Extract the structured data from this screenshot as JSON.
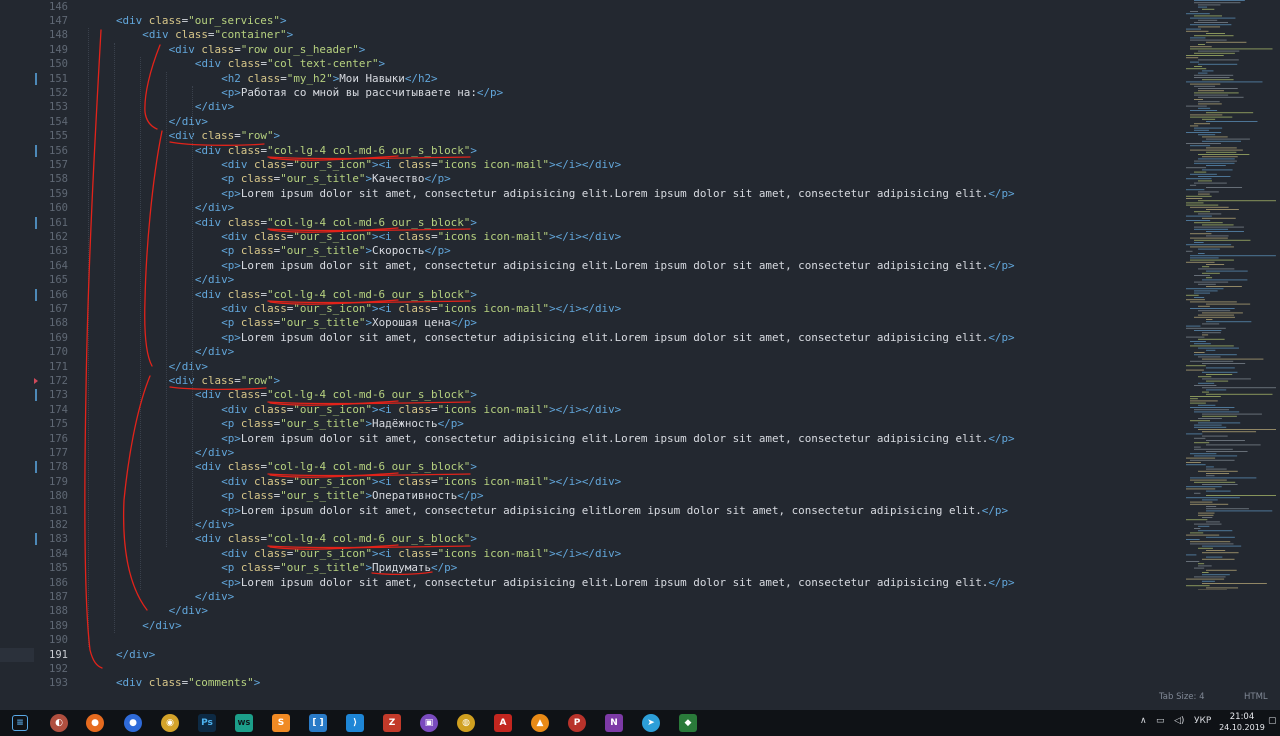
{
  "editor": {
    "lines": [
      {
        "n": "146",
        "segs": []
      },
      {
        "n": "147",
        "segs": [
          [
            "t",
            "<div "
          ],
          [
            "a",
            "class"
          ],
          [
            "x",
            "="
          ],
          [
            "s",
            "\"our_services\""
          ],
          [
            "t",
            ">"
          ]
        ]
      },
      {
        "n": "148",
        "segs": [
          [
            "t",
            "<div "
          ],
          [
            "a",
            "class"
          ],
          [
            "x",
            "="
          ],
          [
            "s",
            "\"container\""
          ],
          [
            "t",
            ">"
          ]
        ]
      },
      {
        "n": "149",
        "segs": [
          [
            "t",
            "<div "
          ],
          [
            "a",
            "class"
          ],
          [
            "x",
            "="
          ],
          [
            "s",
            "\"row our_s_header\""
          ],
          [
            "t",
            ">"
          ]
        ]
      },
      {
        "n": "150",
        "segs": [
          [
            "t",
            "<div "
          ],
          [
            "a",
            "class"
          ],
          [
            "x",
            "="
          ],
          [
            "s",
            "\"col text-center\""
          ],
          [
            "t",
            ">"
          ]
        ]
      },
      {
        "n": "151",
        "segs": [
          [
            "t",
            "<h2 "
          ],
          [
            "a",
            "class"
          ],
          [
            "x",
            "="
          ],
          [
            "s",
            "\"my_h2\""
          ],
          [
            "t",
            ">"
          ],
          [
            "x",
            "Мои Навыки"
          ],
          [
            "t",
            "</h2>"
          ]
        ]
      },
      {
        "n": "152",
        "segs": [
          [
            "t",
            "<p>"
          ],
          [
            "x",
            "Работая со мной вы рассчитываете на:"
          ],
          [
            "t",
            "</p>"
          ]
        ]
      },
      {
        "n": "153",
        "segs": [
          [
            "t",
            "</div>"
          ]
        ]
      },
      {
        "n": "154",
        "segs": [
          [
            "t",
            "</div>"
          ]
        ]
      },
      {
        "n": "155",
        "segs": [
          [
            "t",
            "<div "
          ],
          [
            "a",
            "class"
          ],
          [
            "x",
            "="
          ],
          [
            "s",
            "\"row\""
          ],
          [
            "t",
            ">"
          ]
        ]
      },
      {
        "n": "156",
        "segs": [
          [
            "t",
            "<div "
          ],
          [
            "a",
            "class"
          ],
          [
            "x",
            "="
          ],
          [
            "s",
            "\"col-lg-4 col-md-6 our_s_block\""
          ],
          [
            "t",
            ">"
          ]
        ]
      },
      {
        "n": "157",
        "segs": [
          [
            "t",
            "<div "
          ],
          [
            "a",
            "class"
          ],
          [
            "x",
            "="
          ],
          [
            "s",
            "\"our_s_icon\""
          ],
          [
            "t",
            "><i "
          ],
          [
            "a",
            "class"
          ],
          [
            "x",
            "="
          ],
          [
            "s",
            "\"icons icon-mail\""
          ],
          [
            "t",
            "></i></div>"
          ]
        ]
      },
      {
        "n": "158",
        "segs": [
          [
            "t",
            "<p "
          ],
          [
            "a",
            "class"
          ],
          [
            "x",
            "="
          ],
          [
            "s",
            "\"our_s_title\""
          ],
          [
            "t",
            ">"
          ],
          [
            "x",
            "Качество"
          ],
          [
            "t",
            "</p>"
          ]
        ]
      },
      {
        "n": "159",
        "segs": [
          [
            "t",
            "<p>"
          ],
          [
            "x",
            "Lorem ipsum dolor sit amet, consectetur adipisicing elit.Lorem ipsum dolor sit amet, consectetur adipisicing elit."
          ],
          [
            "t",
            "</p>"
          ]
        ]
      },
      {
        "n": "160",
        "segs": [
          [
            "t",
            "</div>"
          ]
        ]
      },
      {
        "n": "161",
        "segs": [
          [
            "t",
            "<div "
          ],
          [
            "a",
            "class"
          ],
          [
            "x",
            "="
          ],
          [
            "s",
            "\"col-lg-4 col-md-6 our_s_block\""
          ],
          [
            "t",
            ">"
          ]
        ]
      },
      {
        "n": "162",
        "segs": [
          [
            "t",
            "<div "
          ],
          [
            "a",
            "class"
          ],
          [
            "x",
            "="
          ],
          [
            "s",
            "\"our_s_icon\""
          ],
          [
            "t",
            "><i "
          ],
          [
            "a",
            "class"
          ],
          [
            "x",
            "="
          ],
          [
            "s",
            "\"icons icon-mail\""
          ],
          [
            "t",
            "></i></div>"
          ]
        ]
      },
      {
        "n": "163",
        "segs": [
          [
            "t",
            "<p "
          ],
          [
            "a",
            "class"
          ],
          [
            "x",
            "="
          ],
          [
            "s",
            "\"our_s_title\""
          ],
          [
            "t",
            ">"
          ],
          [
            "x",
            "Скорость"
          ],
          [
            "t",
            "</p>"
          ]
        ]
      },
      {
        "n": "164",
        "segs": [
          [
            "t",
            "<p>"
          ],
          [
            "x",
            "Lorem ipsum dolor sit amet, consectetur adipisicing elit.Lorem ipsum dolor sit amet, consectetur adipisicing elit."
          ],
          [
            "t",
            "</p>"
          ]
        ]
      },
      {
        "n": "165",
        "segs": [
          [
            "t",
            "</div>"
          ]
        ]
      },
      {
        "n": "166",
        "segs": [
          [
            "t",
            "<div "
          ],
          [
            "a",
            "class"
          ],
          [
            "x",
            "="
          ],
          [
            "s",
            "\"col-lg-4 col-md-6 our_s_block\""
          ],
          [
            "t",
            ">"
          ]
        ]
      },
      {
        "n": "167",
        "segs": [
          [
            "t",
            "<div "
          ],
          [
            "a",
            "class"
          ],
          [
            "x",
            "="
          ],
          [
            "s",
            "\"our_s_icon\""
          ],
          [
            "t",
            "><i "
          ],
          [
            "a",
            "class"
          ],
          [
            "x",
            "="
          ],
          [
            "s",
            "\"icons icon-mail\""
          ],
          [
            "t",
            "></i></div>"
          ]
        ]
      },
      {
        "n": "168",
        "segs": [
          [
            "t",
            "<p "
          ],
          [
            "a",
            "class"
          ],
          [
            "x",
            "="
          ],
          [
            "s",
            "\"our_s_title\""
          ],
          [
            "t",
            ">"
          ],
          [
            "x",
            "Хорошая цена"
          ],
          [
            "t",
            "</p>"
          ]
        ]
      },
      {
        "n": "169",
        "segs": [
          [
            "t",
            "<p>"
          ],
          [
            "x",
            "Lorem ipsum dolor sit amet, consectetur adipisicing elit.Lorem ipsum dolor sit amet, consectetur adipisicing elit."
          ],
          [
            "t",
            "</p>"
          ]
        ]
      },
      {
        "n": "170",
        "segs": [
          [
            "t",
            "</div>"
          ]
        ]
      },
      {
        "n": "171",
        "segs": [
          [
            "t",
            "</div>"
          ]
        ]
      },
      {
        "n": "172",
        "segs": [
          [
            "t",
            "<div "
          ],
          [
            "a",
            "class"
          ],
          [
            "x",
            "="
          ],
          [
            "s",
            "\"row\""
          ],
          [
            "t",
            ">"
          ]
        ]
      },
      {
        "n": "173",
        "segs": [
          [
            "t",
            "<div "
          ],
          [
            "a",
            "class"
          ],
          [
            "x",
            "="
          ],
          [
            "s",
            "\"col-lg-4 col-md-6 our_s_block\""
          ],
          [
            "t",
            ">"
          ]
        ]
      },
      {
        "n": "174",
        "segs": [
          [
            "t",
            "<div "
          ],
          [
            "a",
            "class"
          ],
          [
            "x",
            "="
          ],
          [
            "s",
            "\"our_s_icon\""
          ],
          [
            "t",
            "><i "
          ],
          [
            "a",
            "class"
          ],
          [
            "x",
            "="
          ],
          [
            "s",
            "\"icons icon-mail\""
          ],
          [
            "t",
            "></i></div>"
          ]
        ]
      },
      {
        "n": "175",
        "segs": [
          [
            "t",
            "<p "
          ],
          [
            "a",
            "class"
          ],
          [
            "x",
            "="
          ],
          [
            "s",
            "\"our_s_title\""
          ],
          [
            "t",
            ">"
          ],
          [
            "x",
            "Надёжность"
          ],
          [
            "t",
            "</p>"
          ]
        ]
      },
      {
        "n": "176",
        "segs": [
          [
            "t",
            "<p>"
          ],
          [
            "x",
            "Lorem ipsum dolor sit amet, consectetur adipisicing elit.Lorem ipsum dolor sit amet, consectetur adipisicing elit."
          ],
          [
            "t",
            "</p>"
          ]
        ]
      },
      {
        "n": "177",
        "segs": [
          [
            "t",
            "</div>"
          ]
        ]
      },
      {
        "n": "178",
        "segs": [
          [
            "t",
            "<div "
          ],
          [
            "a",
            "class"
          ],
          [
            "x",
            "="
          ],
          [
            "s",
            "\"col-lg-4 col-md-6 our_s_block\""
          ],
          [
            "t",
            ">"
          ]
        ]
      },
      {
        "n": "179",
        "segs": [
          [
            "t",
            "<div "
          ],
          [
            "a",
            "class"
          ],
          [
            "x",
            "="
          ],
          [
            "s",
            "\"our_s_icon\""
          ],
          [
            "t",
            "><i "
          ],
          [
            "a",
            "class"
          ],
          [
            "x",
            "="
          ],
          [
            "s",
            "\"icons icon-mail\""
          ],
          [
            "t",
            "></i></div>"
          ]
        ]
      },
      {
        "n": "180",
        "segs": [
          [
            "t",
            "<p "
          ],
          [
            "a",
            "class"
          ],
          [
            "x",
            "="
          ],
          [
            "s",
            "\"our_s_title\""
          ],
          [
            "t",
            ">"
          ],
          [
            "x",
            "Оперативность"
          ],
          [
            "t",
            "</p>"
          ]
        ]
      },
      {
        "n": "181",
        "segs": [
          [
            "t",
            "<p>"
          ],
          [
            "x",
            "Lorem ipsum dolor sit amet, consectetur adipisicing elitLorem ipsum dolor sit amet, consectetur adipisicing elit."
          ],
          [
            "t",
            "</p>"
          ]
        ]
      },
      {
        "n": "182",
        "segs": [
          [
            "t",
            "</div>"
          ]
        ]
      },
      {
        "n": "183",
        "segs": [
          [
            "t",
            "<div "
          ],
          [
            "a",
            "class"
          ],
          [
            "x",
            "="
          ],
          [
            "s",
            "\"col-lg-4 col-md-6 our_s_block\""
          ],
          [
            "t",
            ">"
          ]
        ]
      },
      {
        "n": "184",
        "segs": [
          [
            "t",
            "<div "
          ],
          [
            "a",
            "class"
          ],
          [
            "x",
            "="
          ],
          [
            "s",
            "\"our_s_icon\""
          ],
          [
            "t",
            "><i "
          ],
          [
            "a",
            "class"
          ],
          [
            "x",
            "="
          ],
          [
            "s",
            "\"icons icon-mail\""
          ],
          [
            "t",
            "></i></div>"
          ]
        ]
      },
      {
        "n": "185",
        "segs": [
          [
            "t",
            "<p "
          ],
          [
            "a",
            "class"
          ],
          [
            "x",
            "="
          ],
          [
            "s",
            "\"our_s_title\""
          ],
          [
            "t",
            ">"
          ],
          [
            "x",
            "Придумать"
          ],
          [
            "t",
            "</p>"
          ]
        ]
      },
      {
        "n": "186",
        "segs": [
          [
            "t",
            "<p>"
          ],
          [
            "x",
            "Lorem ipsum dolor sit amet, consectetur adipisicing elit.Lorem ipsum dolor sit amet, consectetur adipisicing elit."
          ],
          [
            "t",
            "</p>"
          ]
        ]
      },
      {
        "n": "187",
        "segs": [
          [
            "t",
            "</div>"
          ]
        ]
      },
      {
        "n": "188",
        "segs": [
          [
            "t",
            "</div>"
          ]
        ]
      },
      {
        "n": "189",
        "segs": [
          [
            "t",
            "</div>"
          ]
        ]
      },
      {
        "n": "190",
        "segs": []
      },
      {
        "n": "191",
        "segs": [
          [
            "t",
            "</div>"
          ]
        ]
      },
      {
        "n": "192",
        "segs": []
      },
      {
        "n": "193",
        "segs": [
          [
            "t",
            "<div "
          ],
          [
            "a",
            "class"
          ],
          [
            "x",
            "="
          ],
          [
            "s",
            "\"comments\""
          ],
          [
            "t",
            ">"
          ]
        ]
      }
    ],
    "active_line": "191"
  },
  "statusbar": {
    "tab_size": "Tab Size: 4",
    "syntax": "HTML"
  },
  "taskbar": {
    "icons": [
      "start-icon",
      "app-icon",
      "firefox-icon",
      "firefox-dev-icon",
      "chrome-icon",
      "photoshop-icon",
      "webstorm-icon",
      "sublime-icon",
      "brackets-icon",
      "vscode-icon",
      "filezilla-icon",
      "twitch-icon",
      "paint-icon",
      "pdf-reader-icon",
      "avast-icon",
      "proxy-icon",
      "onenote-icon",
      "telegram-icon",
      "git-icon"
    ],
    "tray": {
      "chevron": "∧",
      "lang": "УКР",
      "time": "21:04",
      "date": "24.10.2019"
    }
  },
  "colors": {
    "background": "#232830",
    "tag": "#62a6da",
    "attr": "#d8c78a",
    "string": "#b6d17f",
    "text": "#d7dae0",
    "annotation": "#e2231a"
  }
}
